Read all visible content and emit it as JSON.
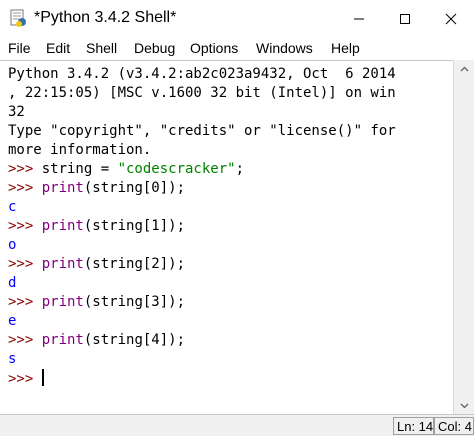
{
  "window": {
    "title": "*Python 3.4.2 Shell*",
    "icon": "python-idle-icon",
    "controls": {
      "minimize": "minimize-icon",
      "maximize": "maximize-icon",
      "close": "close-icon"
    }
  },
  "menu": {
    "items": [
      "File",
      "Edit",
      "Shell",
      "Debug",
      "Options",
      "Windows",
      "Help"
    ]
  },
  "shell": {
    "banner": [
      "Python 3.4.2 (v3.4.2:ab2c023a9432, Oct  6 2014",
      ", 22:15:05) [MSC v.1600 32 bit (Intel)] on win",
      "32",
      "Type \"copyright\", \"credits\" or \"license()\" for",
      "more information."
    ],
    "prompt": ">>> ",
    "assign": {
      "var": "string = ",
      "value": "\"codescracker\"",
      "end": ";"
    },
    "keyword": "print",
    "calls": [
      "(string[0]);",
      "(string[1]);",
      "(string[2]);",
      "(string[3]);",
      "(string[4]);"
    ],
    "outputs": [
      "c",
      "o",
      "d",
      "e",
      "s"
    ]
  },
  "status": {
    "line": "Ln: 14",
    "col": "Col: 4"
  },
  "colors": {
    "prompt": "#8b0000",
    "keyword": "#800080",
    "string": "#008000",
    "output": "#0000ff"
  }
}
